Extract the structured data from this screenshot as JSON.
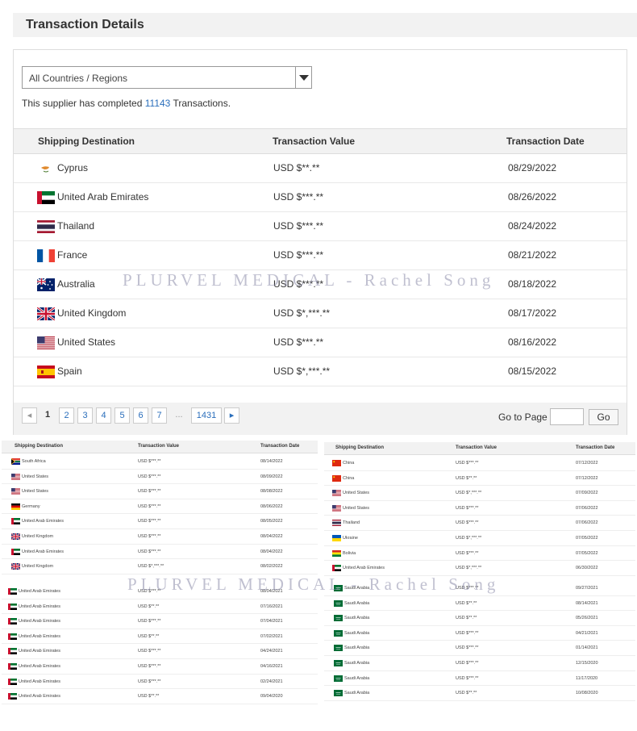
{
  "title": "Transaction Details",
  "filter": {
    "value": "All Countries / Regions"
  },
  "summary": {
    "prefix": "This supplier has completed ",
    "count": "11143",
    "suffix": " Transactions."
  },
  "headers": {
    "dest": "Shipping Destination",
    "value": "Transaction Value",
    "date": "Transaction Date"
  },
  "rows": [
    {
      "country": "Cyprus",
      "flag": "cyprus-flag-icon",
      "value": "USD $**.**",
      "date": "08/29/2022"
    },
    {
      "country": "United Arab Emirates",
      "flag": "uae-flag-icon",
      "value": "USD $***.**",
      "date": "08/26/2022"
    },
    {
      "country": "Thailand",
      "flag": "thailand-flag-icon",
      "value": "USD $***.**",
      "date": "08/24/2022"
    },
    {
      "country": "France",
      "flag": "france-flag-icon",
      "value": "USD $***.**",
      "date": "08/21/2022"
    },
    {
      "country": "Australia",
      "flag": "australia-flag-icon",
      "value": "USD $***.**",
      "date": "08/18/2022"
    },
    {
      "country": "United Kingdom",
      "flag": "uk-flag-icon",
      "value": "USD $*,***.**",
      "date": "08/17/2022"
    },
    {
      "country": "United States",
      "flag": "us-flag-icon",
      "value": "USD $***.**",
      "date": "08/16/2022"
    },
    {
      "country": "Spain",
      "flag": "spain-flag-icon",
      "value": "USD $*,***.**",
      "date": "08/15/2022"
    }
  ],
  "pagination": {
    "pages": [
      "1",
      "2",
      "3",
      "4",
      "5",
      "6",
      "7"
    ],
    "ellipsis": "...",
    "last": "1431",
    "goto_label": "Go to Page",
    "go_button": "Go"
  },
  "mini_left_top": [
    {
      "country": "South Africa",
      "value": "USD $***.**",
      "date": "08/14/2022"
    },
    {
      "country": "United States",
      "value": "USD $***.**",
      "date": "08/09/2022"
    },
    {
      "country": "United States",
      "value": "USD $***.**",
      "date": "08/08/2022"
    },
    {
      "country": "Germany",
      "value": "USD $***.**",
      "date": "08/06/2022"
    },
    {
      "country": "United Arab Emirates",
      "value": "USD $***.**",
      "date": "08/05/2022"
    },
    {
      "country": "United Kingdom",
      "value": "USD $***.**",
      "date": "08/04/2022"
    },
    {
      "country": "United Arab Emirates",
      "value": "USD $***.**",
      "date": "08/04/2022"
    },
    {
      "country": "United Kingdom",
      "value": "USD $*,***.**",
      "date": "08/02/2022"
    }
  ],
  "mini_left_bottom": [
    {
      "country": "United Arab Emirates",
      "value": "USD $***.**",
      "date": "08/04/2021"
    },
    {
      "country": "United Arab Emirates",
      "value": "USD $**.**",
      "date": "07/16/2021"
    },
    {
      "country": "United Arab Emirates",
      "value": "USD $***.**",
      "date": "07/04/2021"
    },
    {
      "country": "United Arab Emirates",
      "value": "USD $**.**",
      "date": "07/02/2021"
    },
    {
      "country": "United Arab Emirates",
      "value": "USD $***.**",
      "date": "04/24/2021"
    },
    {
      "country": "United Arab Emirates",
      "value": "USD $***.**",
      "date": "04/16/2021"
    },
    {
      "country": "United Arab Emirates",
      "value": "USD $***.**",
      "date": "02/24/2021"
    },
    {
      "country": "United Arab Emirates",
      "value": "USD $**.**",
      "date": "09/04/2020"
    }
  ],
  "mini_right_top": [
    {
      "country": "China",
      "value": "USD $***.**",
      "date": "07/12/2022"
    },
    {
      "country": "China",
      "value": "USD $**.**",
      "date": "07/12/2022"
    },
    {
      "country": "United States",
      "value": "USD $*,***.**",
      "date": "07/09/2022"
    },
    {
      "country": "United States",
      "value": "USD $***.**",
      "date": "07/06/2022"
    },
    {
      "country": "Thailand",
      "value": "USD $***.**",
      "date": "07/06/2022"
    },
    {
      "country": "Ukraine",
      "value": "USD $*,***.**",
      "date": "07/05/2022"
    },
    {
      "country": "Bolivia",
      "value": "USD $***.**",
      "date": "07/05/2022"
    },
    {
      "country": "United Arab Emirates",
      "value": "USD $*,***.**",
      "date": "06/30/2022"
    }
  ],
  "mini_right_bottom": [
    {
      "country": "Saudi Arabia",
      "value": "USD $***.**",
      "date": "09/27/2021"
    },
    {
      "country": "Saudi Arabia",
      "value": "USD $**.**",
      "date": "08/14/2021"
    },
    {
      "country": "Saudi Arabia",
      "value": "USD $**.**",
      "date": "05/26/2021"
    },
    {
      "country": "Saudi Arabia",
      "value": "USD $***.**",
      "date": "04/21/2021"
    },
    {
      "country": "Saudi Arabia",
      "value": "USD $***.**",
      "date": "01/14/2021"
    },
    {
      "country": "Saudi Arabia",
      "value": "USD $***.**",
      "date": "12/15/2020"
    },
    {
      "country": "Saudi Arabia",
      "value": "USD $***.**",
      "date": "11/17/2020"
    },
    {
      "country": "Saudi Arabia",
      "value": "USD $**.**",
      "date": "10/08/2020"
    }
  ],
  "watermark": "PLURVEL MEDICAL - Rachel Song",
  "colors": {
    "link": "#2a6ebb",
    "header_bg": "#f2f2f2"
  }
}
